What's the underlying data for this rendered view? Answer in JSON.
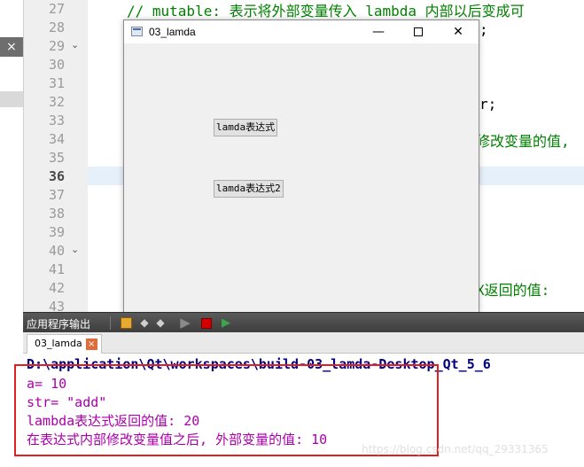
{
  "editor": {
    "left_strip": {
      "close_glyph": "×"
    },
    "line_numbers": [
      "27",
      "28",
      "29",
      "30",
      "31",
      "32",
      "33",
      "34",
      "35",
      "36",
      "37",
      "38",
      "39",
      "40",
      "41",
      "42",
      "43"
    ],
    "fold_markers": [
      "⌄",
      "⌄"
    ],
    "code_fragments": [
      {
        "text": "// mutable: 表示将外部变量传入 lambda 内部以后变成可",
        "style": "comment"
      },
      {
        "text": ";",
        "style": "plain"
      },
      {
        "text": "r;",
        "style": "plain"
      },
      {
        "text": "修改变量的值,",
        "style": "comment"
      },
      {
        "text": "X返回的值:",
        "style": "comment"
      }
    ]
  },
  "app_window": {
    "title": "03_lamda",
    "controls": {
      "minimize": "—",
      "maximize": "",
      "close": "✕"
    },
    "buttons": [
      "lamda表达式",
      "lamda表达式2"
    ]
  },
  "output_pane": {
    "title": "应用程序输出",
    "toolbar_icons": [
      "clean-output-icon",
      "previous-icon",
      "next-icon",
      "run-icon",
      "stop-icon",
      "attach-debugger-icon"
    ],
    "tab": {
      "label": "03_lamda",
      "close_glyph": "×"
    },
    "lines": {
      "path": "D:\\application\\Qt\\workspaces\\build-03_lamda-Desktop_Qt_5_6",
      "a": "a= 10",
      "str": "str= \"add\"",
      "lambda_return": "lambda表达式返回的值:  20",
      "final": "在表达式内部修改变量值之后, 外部变量的值:  10"
    },
    "watermark": "https://blog.csdn.net/qq_29331365"
  },
  "colors": {
    "output_text": "#aa00aa",
    "path_text": "#00007f",
    "comment": "#008000",
    "highlight_border": "#e02020",
    "current_line": "#e6f0fa"
  }
}
